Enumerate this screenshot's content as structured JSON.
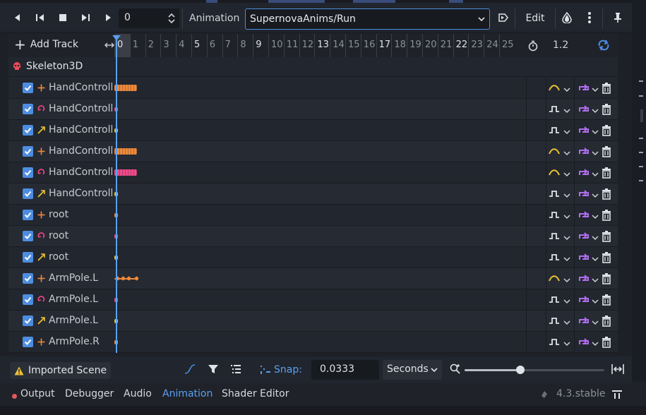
{
  "toolbar": {
    "frame_value": "0",
    "animation_label": "Animation",
    "animation_selected": "SupernovaAnims/Run",
    "edit_label": "Edit"
  },
  "timeline": {
    "add_track_label": "Add Track",
    "ticks": [
      "0",
      "1",
      "2",
      "3",
      "4",
      "5",
      "6",
      "7",
      "8",
      "9",
      "10",
      "11",
      "12",
      "13",
      "14",
      "15",
      "16",
      "17",
      "18",
      "19",
      "20",
      "21",
      "22",
      "23",
      "24",
      "25"
    ],
    "major_ticks": [
      "0",
      "5",
      "9",
      "13",
      "17",
      "22"
    ],
    "length_value": "1.2",
    "root_node": "Skeleton3D"
  },
  "tracks": [
    {
      "name": "HandControll",
      "type": "position",
      "interp": "cubic",
      "keys": "dense"
    },
    {
      "name": "HandControll",
      "type": "rotation",
      "interp": "nearest",
      "keys": "single"
    },
    {
      "name": "HandControll",
      "type": "scale",
      "interp": "nearest",
      "keys": "single"
    },
    {
      "name": "HandControll",
      "type": "position",
      "interp": "cubic",
      "keys": "dense"
    },
    {
      "name": "HandControll",
      "type": "rotation",
      "interp": "cubic",
      "keys": "dense"
    },
    {
      "name": "HandControll",
      "type": "scale",
      "interp": "nearest",
      "keys": "single"
    },
    {
      "name": "root",
      "type": "position",
      "interp": "nearest",
      "keys": "single"
    },
    {
      "name": "root",
      "type": "rotation",
      "interp": "nearest",
      "keys": "single"
    },
    {
      "name": "root",
      "type": "scale",
      "interp": "nearest",
      "keys": "single"
    },
    {
      "name": "ArmPole.L",
      "type": "position",
      "interp": "cubic",
      "keys": "sparse"
    },
    {
      "name": "ArmPole.L",
      "type": "rotation",
      "interp": "nearest",
      "keys": "single"
    },
    {
      "name": "ArmPole.L",
      "type": "scale",
      "interp": "nearest",
      "keys": "single"
    },
    {
      "name": "ArmPole.R",
      "type": "position",
      "interp": "nearest",
      "keys": "single"
    }
  ],
  "bottombar": {
    "imported_label": "Imported Scene",
    "snap_label": "Snap:",
    "snap_value": "0.0333",
    "units_value": "Seconds",
    "zoom_level": 0.4
  },
  "tabs": {
    "output": "Output",
    "debugger": "Debugger",
    "audio": "Audio",
    "animation": "Animation",
    "shader_editor": "Shader Editor",
    "version": "4.3.stable"
  },
  "colors": {
    "accent": "#4d8de0",
    "position": "#f08a3a",
    "rotation": "#f04a8a",
    "scale": "#e6c232",
    "loop": "#b06ef0",
    "interp_cubic": "#e6c232"
  }
}
